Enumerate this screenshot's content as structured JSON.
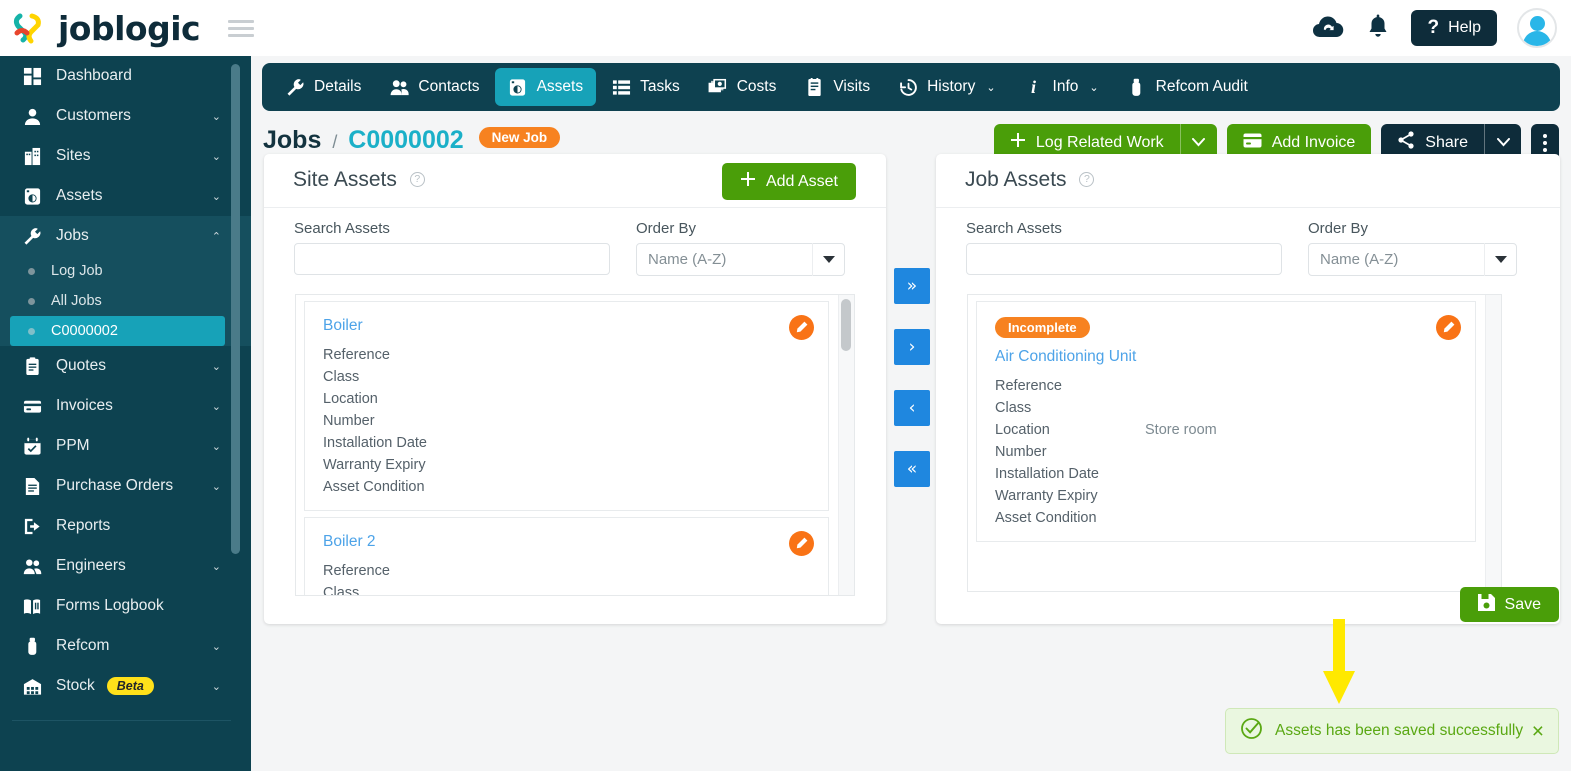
{
  "brand": {
    "name": "joblogic"
  },
  "header": {
    "menu_icon": "hamburger-icon",
    "sync_icon": "cloud-sync-icon",
    "notifications_icon": "bell-icon",
    "help_label": "Help",
    "help_mark": "?",
    "avatar": "user-avatar"
  },
  "sidebar": {
    "items": [
      {
        "label": "Dashboard",
        "icon": "dashboard-icon",
        "chevron": "",
        "active": false
      },
      {
        "label": "Customers",
        "icon": "user-icon",
        "chevron": "⌄",
        "active": false
      },
      {
        "label": "Sites",
        "icon": "building-icon",
        "chevron": "⌄",
        "active": false
      },
      {
        "label": "Assets",
        "icon": "asset-icon",
        "chevron": "⌄",
        "active": false
      },
      {
        "label": "Jobs",
        "icon": "wrench-icon",
        "chevron": "⌃",
        "active": true
      },
      {
        "label": "Quotes",
        "icon": "clipboard-icon",
        "chevron": "⌄",
        "active": false
      },
      {
        "label": "Invoices",
        "icon": "card-icon",
        "chevron": "⌄",
        "active": false
      },
      {
        "label": "PPM",
        "icon": "calendar-check-icon",
        "chevron": "⌄",
        "active": false
      },
      {
        "label": "Purchase Orders",
        "icon": "document-icon",
        "chevron": "⌄",
        "active": false
      },
      {
        "label": "Reports",
        "icon": "export-icon",
        "chevron": "",
        "active": false
      },
      {
        "label": "Engineers",
        "icon": "people-icon",
        "chevron": "⌄",
        "active": false
      },
      {
        "label": "Forms Logbook",
        "icon": "book-icon",
        "chevron": "",
        "active": false
      },
      {
        "label": "Refcom",
        "icon": "cylinder-icon",
        "chevron": "⌄",
        "active": false
      },
      {
        "label": "Stock",
        "icon": "warehouse-icon",
        "chevron": "⌄",
        "badge": "Beta",
        "active": false
      }
    ],
    "jobs_submenu": [
      {
        "label": "Log Job",
        "selected": false
      },
      {
        "label": "All Jobs",
        "selected": false
      },
      {
        "label": "C0000002",
        "selected": true
      }
    ]
  },
  "tabs": [
    {
      "label": "Details",
      "icon": "wrench-icon",
      "active": false,
      "caret": ""
    },
    {
      "label": "Contacts",
      "icon": "contacts-icon",
      "active": false,
      "caret": ""
    },
    {
      "label": "Assets",
      "icon": "asset-icon",
      "active": true,
      "caret": ""
    },
    {
      "label": "Tasks",
      "icon": "list-icon",
      "active": false,
      "caret": ""
    },
    {
      "label": "Costs",
      "icon": "money-icon",
      "active": false,
      "caret": ""
    },
    {
      "label": "Visits",
      "icon": "notepad-icon",
      "active": false,
      "caret": ""
    },
    {
      "label": "History",
      "icon": "clock-back-icon",
      "active": false,
      "caret": "⌄"
    },
    {
      "label": "Info",
      "icon": "info-icon",
      "active": false,
      "caret": "⌄"
    },
    {
      "label": "Refcom Audit",
      "icon": "cylinder-icon",
      "active": false,
      "caret": ""
    }
  ],
  "breadcrumb": {
    "root": "Jobs",
    "separator": "/",
    "code": "C0000002",
    "status_badge": "New Job"
  },
  "actions": {
    "log_related_work": "Log Related Work",
    "add_invoice": "Add Invoice",
    "share": "Share",
    "caret": "⌄",
    "kebab": "more-options"
  },
  "site_assets": {
    "title": "Site Assets",
    "help_mark": "?",
    "add_asset_label": "Add Asset",
    "search_label": "Search Assets",
    "search_value": "",
    "search_placeholder": "",
    "order_label": "Order By",
    "order_value": "Name (A-Z)",
    "cards": [
      {
        "name": "Boiler",
        "attrs": [
          {
            "k": "Reference",
            "v": ""
          },
          {
            "k": "Class",
            "v": ""
          },
          {
            "k": "Location",
            "v": ""
          },
          {
            "k": "Number",
            "v": ""
          },
          {
            "k": "Installation Date",
            "v": ""
          },
          {
            "k": "Warranty Expiry",
            "v": ""
          },
          {
            "k": "Asset Condition",
            "v": ""
          }
        ]
      },
      {
        "name": "Boiler 2",
        "attrs": [
          {
            "k": "Reference",
            "v": ""
          },
          {
            "k": "Class",
            "v": ""
          }
        ]
      }
    ]
  },
  "job_assets": {
    "title": "Job Assets",
    "help_mark": "?",
    "search_label": "Search Assets",
    "search_value": "",
    "search_placeholder": "",
    "order_label": "Order By",
    "order_value": "Name (A-Z)",
    "cards": [
      {
        "badge": "Incomplete",
        "name": "Air Conditioning Unit",
        "attrs": [
          {
            "k": "Reference",
            "v": ""
          },
          {
            "k": "Class",
            "v": ""
          },
          {
            "k": "Location",
            "v": "Store room"
          },
          {
            "k": "Number",
            "v": ""
          },
          {
            "k": "Installation Date",
            "v": ""
          },
          {
            "k": "Warranty Expiry",
            "v": ""
          },
          {
            "k": "Asset Condition",
            "v": ""
          }
        ]
      }
    ]
  },
  "transfer_buttons": [
    {
      "glyph": "»",
      "name": "move-all-right"
    },
    {
      "glyph": "›",
      "name": "move-right"
    },
    {
      "glyph": "‹",
      "name": "move-left"
    },
    {
      "glyph": "«",
      "name": "move-all-left"
    }
  ],
  "save": {
    "label": "Save"
  },
  "toast": {
    "message": "Assets has been saved successfully",
    "close": "×",
    "icon": "check-circle-icon"
  },
  "colors": {
    "brand_dark": "#0d4250",
    "accent_teal": "#17a2b8",
    "accent_green": "#4a9e09",
    "accent_orange": "#f78220",
    "link_blue": "#4da3e8",
    "transfer_blue": "#1f87df",
    "annotation_yellow": "#ffe900",
    "toast_green": "#5aa813"
  }
}
